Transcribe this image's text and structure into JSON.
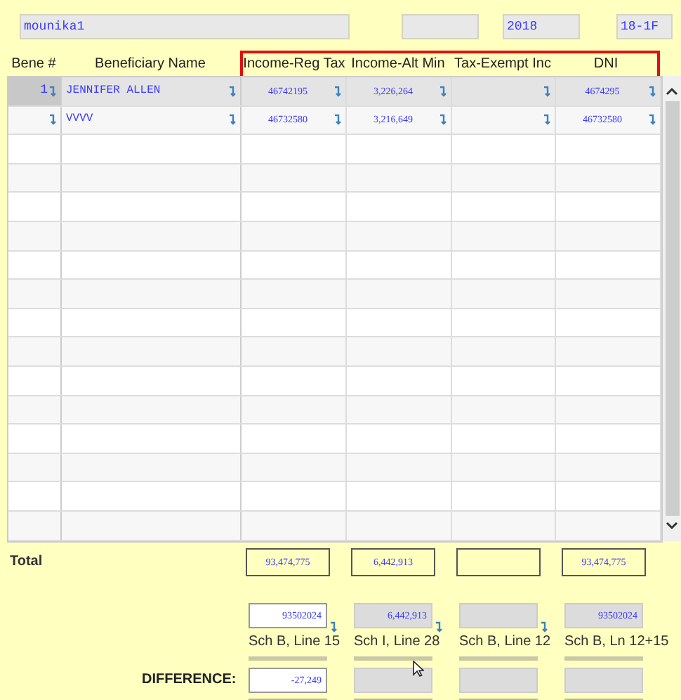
{
  "header": {
    "name": "mounika1",
    "year": "2018",
    "form": "18-1F"
  },
  "columns": [
    "Bene #",
    "Beneficiary Name"
  ],
  "highlighted_columns": [
    "Income-Reg Tax",
    "Income-Alt Min",
    "Tax-Exempt Inc",
    "DNI"
  ],
  "rows": [
    {
      "selected": true,
      "bene": "1",
      "name": "JENNIFER ALLEN",
      "reg_tax": "46742195",
      "alt_min": "3,226,264",
      "dni": "4674295"
    },
    {
      "selected": false,
      "name": "VVVV",
      "reg_tax": "46732580",
      "alt_min": "3,216,649",
      "dni": "46732580"
    }
  ],
  "total": {
    "label": "Total",
    "reg_tax": "93,474,775",
    "alt_min": "6,442,913",
    "dni": "93,474,775"
  },
  "schedule": [
    {
      "value": "93502024",
      "editable": true,
      "linked": true,
      "label": "Sch B, Line 15"
    },
    {
      "value": "6,442,913",
      "editable": false,
      "linked": true,
      "label": "Sch I, Line 28"
    },
    {
      "editable": false,
      "linked": true,
      "label": "Sch B, Line 12"
    },
    {
      "value": "93502024",
      "editable": false,
      "linked": false,
      "label": "Sch B, Ln 12+15"
    }
  ],
  "difference": {
    "label": "DIFFERENCE:",
    "values": [
      {
        "value": "-27,249",
        "editable": true
      },
      {
        "editable": false
      },
      {
        "editable": false
      },
      {
        "editable": false
      }
    ]
  }
}
